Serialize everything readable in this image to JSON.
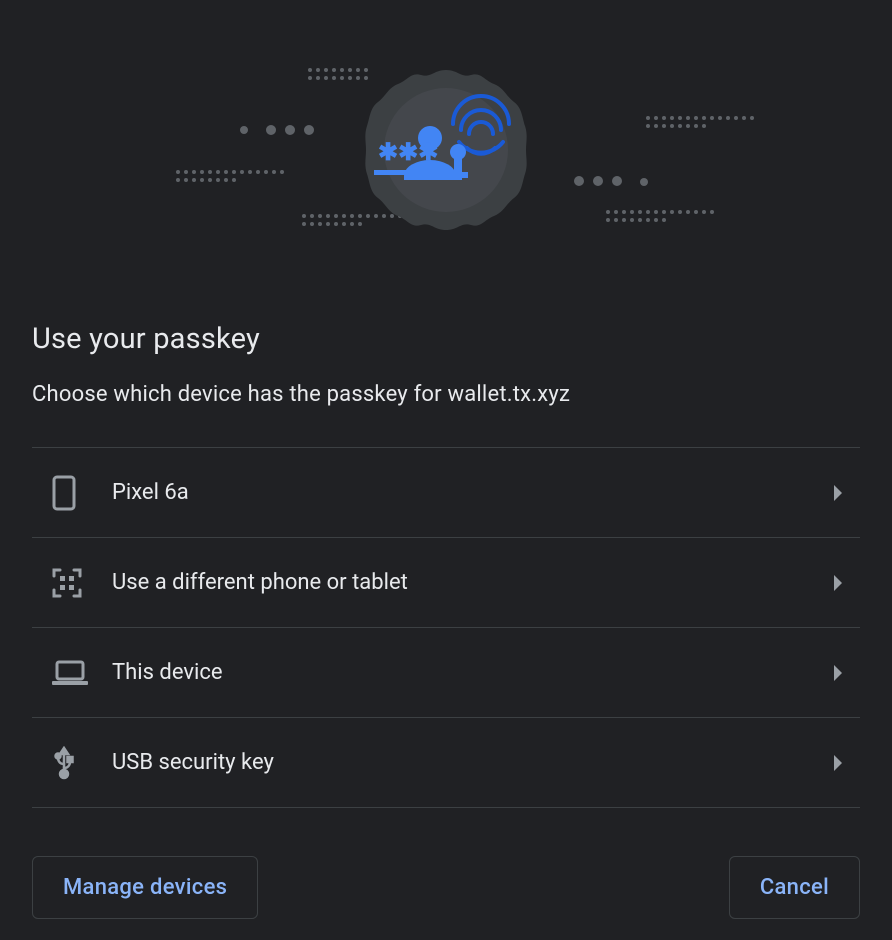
{
  "header": {
    "title": "Use your passkey",
    "subtitle": "Choose which device has the passkey for wallet.tx.xyz"
  },
  "options": [
    {
      "icon": "smartphone-icon",
      "label": "Pixel 6a"
    },
    {
      "icon": "qr-icon",
      "label": "Use a different phone or tablet"
    },
    {
      "icon": "laptop-icon",
      "label": "This device"
    },
    {
      "icon": "usb-icon",
      "label": "USB security key"
    }
  ],
  "footer": {
    "manage_label": "Manage devices",
    "cancel_label": "Cancel"
  },
  "colors": {
    "accent": "#8ab4f8",
    "illustration_blue": "#4285f4",
    "bg": "#202124",
    "muted": "#9aa0a6",
    "divider": "#3c4043"
  }
}
